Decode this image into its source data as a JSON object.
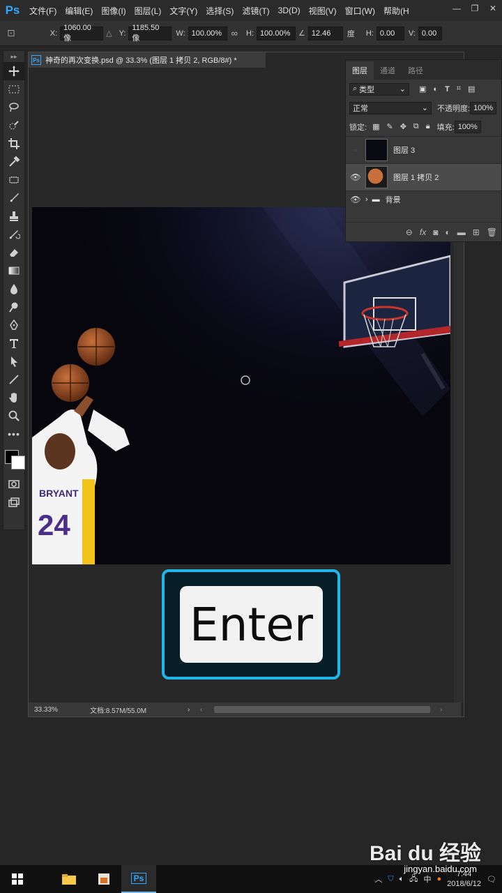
{
  "app": {
    "logo": "Ps"
  },
  "menu": [
    "文件(F)",
    "编辑(E)",
    "图像(I)",
    "图层(L)",
    "文字(Y)",
    "选择(S)",
    "滤镜(T)",
    "3D(D)",
    "视图(V)",
    "窗口(W)",
    "帮助(H"
  ],
  "window_controls": [
    "—",
    "❐",
    "✕"
  ],
  "options": {
    "x_label": "X:",
    "x_value": "1060.00 像",
    "y_label": "Y:",
    "y_value": "1185.50 像",
    "w_label": "W:",
    "w_value": "100.00%",
    "link_icon": "link-icon",
    "h_label": "H:",
    "h_value": "100.00%",
    "angle_value": "12.46",
    "angle_unit": "度",
    "hskew_label": "H:",
    "hskew_value": "0.00",
    "vskew_label": "V:",
    "vskew_value": "0.00",
    "unit": "度"
  },
  "document": {
    "tab_title": "神奇的再次变换.psd @ 33.3% (图层 1 拷贝 2, RGB/8#) *",
    "zoom": "33.33%",
    "doc_info": "文档:8.57M/55.0M"
  },
  "enter_key": {
    "label": "Enter",
    "accent": "#1fb6e8"
  },
  "layers_panel": {
    "tabs": [
      "图层",
      "通道",
      "路径"
    ],
    "filter_kind": "类型",
    "blend_mode": "正常",
    "opacity_label": "不透明度:",
    "opacity": "100%",
    "lock_label": "锁定:",
    "fill_label": "填充:",
    "fill": "100%",
    "layers": [
      {
        "name": "图层 3",
        "visible": false,
        "selected": false
      },
      {
        "name": "图层 1 拷贝 2",
        "visible": true,
        "selected": true
      },
      {
        "name": "背景",
        "visible": true,
        "selected": false,
        "group": true
      }
    ]
  },
  "taskbar": {
    "tray_ime": "中",
    "time": "7:44",
    "date": "2018/6/12"
  },
  "watermark": {
    "brand": "Bai du 经验",
    "site": "jingyan.baidu.com"
  }
}
